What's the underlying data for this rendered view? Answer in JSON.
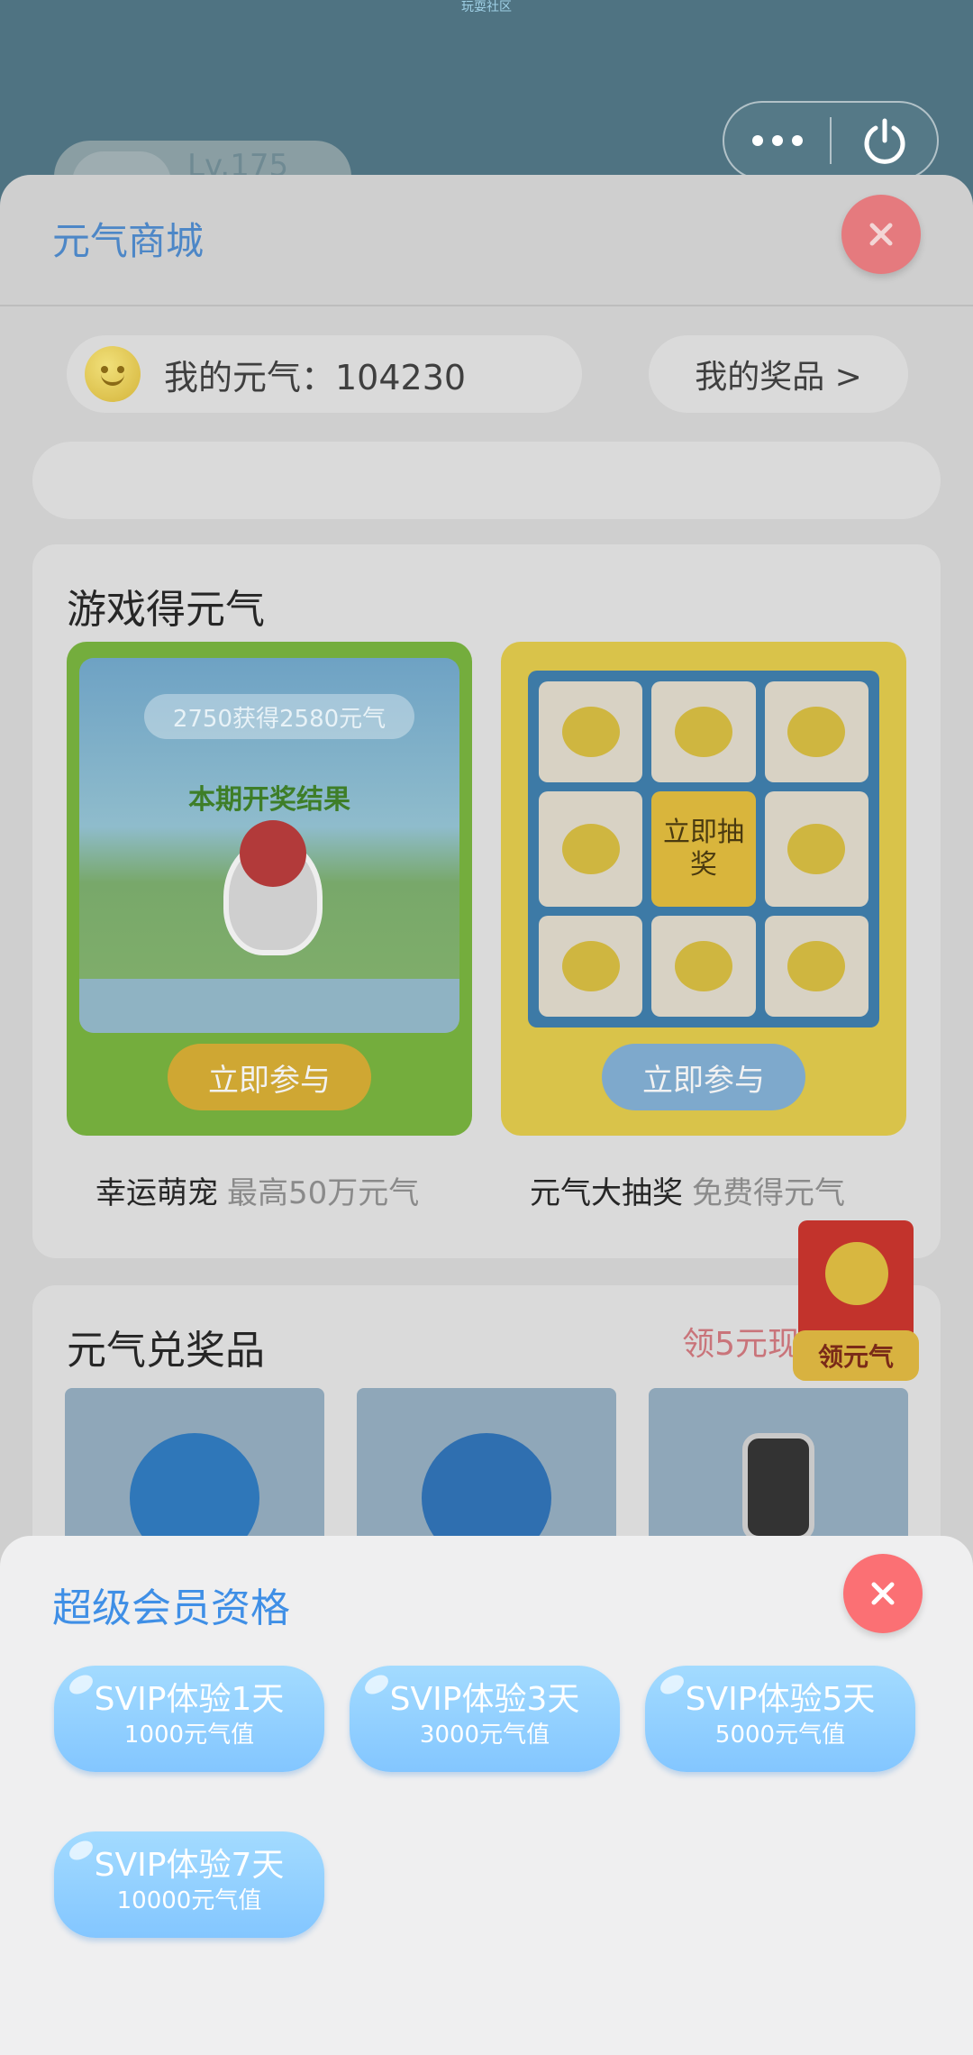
{
  "top_bar": {
    "label": "玩耍社区"
  },
  "profile": {
    "level": "Lv.175"
  },
  "mall": {
    "title": "元气商城",
    "balance_label": "我的元气：104230",
    "my_prizes": "我的奖品 >",
    "games_section": {
      "title": "游戏得元气",
      "games": [
        {
          "name": "幸运萌宠",
          "subtitle": "最高50万元气",
          "banner_text": "2750获得2580元气",
          "result_text": "本期开奖结果",
          "button": "立即参与"
        },
        {
          "name": "元气大抽奖",
          "subtitle": "免费得元气",
          "center_text": "立即抽奖",
          "button": "立即参与"
        }
      ]
    },
    "prizes_section": {
      "title": "元气兑奖品",
      "cash_link": "领5元现金"
    },
    "red_packet": {
      "label": "领元气"
    }
  },
  "svip": {
    "title": "超级会员资格",
    "options": [
      {
        "name": "SVIP体验1天",
        "cost": "1000元气值"
      },
      {
        "name": "SVIP体验3天",
        "cost": "3000元气值"
      },
      {
        "name": "SVIP体验5天",
        "cost": "5000元气值"
      },
      {
        "name": "SVIP体验7天",
        "cost": "10000元气值"
      }
    ]
  },
  "colors": {
    "accent_blue": "#3f8fe6",
    "close_red": "#fb7074",
    "svip_button": "#8dcbff"
  },
  "icons": [
    "more-icon",
    "power-icon",
    "close-icon",
    "smiley-coin-icon",
    "qq-penguin-icon",
    "growth-chart-icon",
    "smartwatch-icon",
    "red-packet-icon"
  ]
}
